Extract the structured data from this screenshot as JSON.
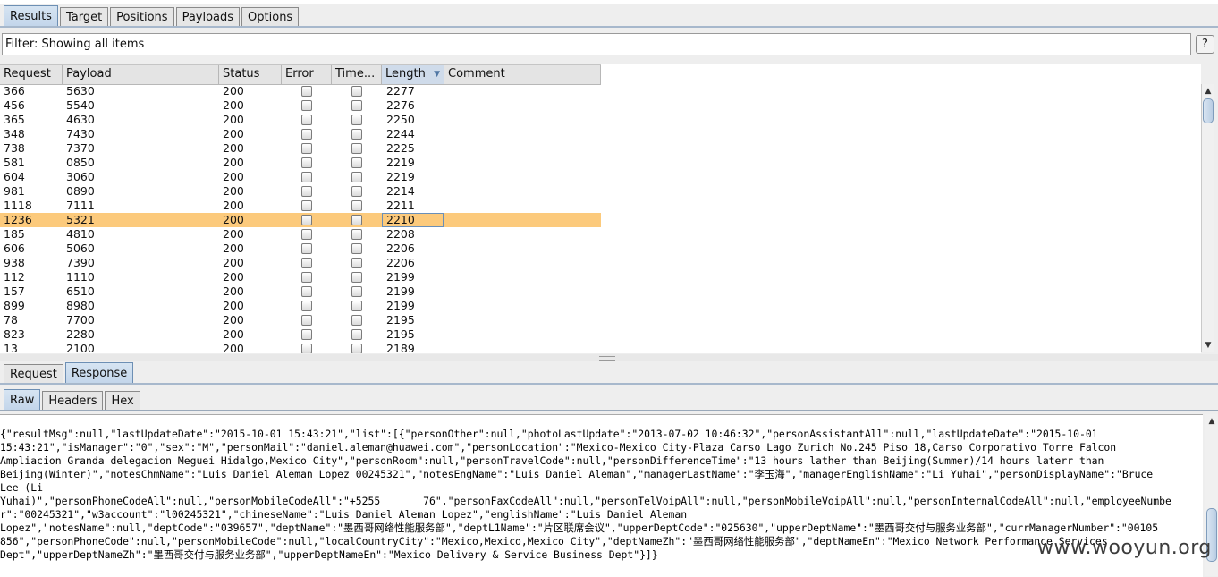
{
  "main_tabs": [
    "Results",
    "Target",
    "Positions",
    "Payloads",
    "Options"
  ],
  "filter_text": "Filter: Showing all items",
  "help_label": "?",
  "columns": [
    "Request",
    "Payload",
    "Status",
    "Error",
    "Time...",
    "Length",
    "Comment"
  ],
  "sort_indicator": "▼",
  "rows": [
    {
      "request": "366",
      "payload": "5630",
      "status": "200",
      "length": "2277"
    },
    {
      "request": "456",
      "payload": "5540",
      "status": "200",
      "length": "2276"
    },
    {
      "request": "365",
      "payload": "4630",
      "status": "200",
      "length": "2250"
    },
    {
      "request": "348",
      "payload": "7430",
      "status": "200",
      "length": "2244"
    },
    {
      "request": "738",
      "payload": "7370",
      "status": "200",
      "length": "2225"
    },
    {
      "request": "581",
      "payload": "0850",
      "status": "200",
      "length": "2219"
    },
    {
      "request": "604",
      "payload": "3060",
      "status": "200",
      "length": "2219"
    },
    {
      "request": "981",
      "payload": "0890",
      "status": "200",
      "length": "2214"
    },
    {
      "request": "1118",
      "payload": "7111",
      "status": "200",
      "length": "2211"
    },
    {
      "request": "1236",
      "payload": "5321",
      "status": "200",
      "length": "2210",
      "selected": true
    },
    {
      "request": "185",
      "payload": "4810",
      "status": "200",
      "length": "2208"
    },
    {
      "request": "606",
      "payload": "5060",
      "status": "200",
      "length": "2206"
    },
    {
      "request": "938",
      "payload": "7390",
      "status": "200",
      "length": "2206"
    },
    {
      "request": "112",
      "payload": "1110",
      "status": "200",
      "length": "2199"
    },
    {
      "request": "157",
      "payload": "6510",
      "status": "200",
      "length": "2199"
    },
    {
      "request": "899",
      "payload": "8980",
      "status": "200",
      "length": "2199"
    },
    {
      "request": "78",
      "payload": "7700",
      "status": "200",
      "length": "2195"
    },
    {
      "request": "823",
      "payload": "2280",
      "status": "200",
      "length": "2195"
    },
    {
      "request": "13",
      "payload": "2100",
      "status": "200",
      "length": "2189"
    }
  ],
  "message_tabs": [
    "Request",
    "Response"
  ],
  "view_tabs": [
    "Raw",
    "Headers",
    "Hex"
  ],
  "raw_lines": [
    "{\"resultMsg\":null,\"lastUpdateDate\":\"2015-10-01 15:43:21\",\"list\":[{\"personOther\":null,\"photoLastUpdate\":\"2013-07-02 10:46:32\",\"personAssistantAll\":null,\"lastUpdateDate\":\"2015-10-01",
    "15:43:21\",\"isManager\":\"0\",\"sex\":\"M\",\"personMail\":\"daniel.aleman@huawei.com\",\"personLocation\":\"Mexico-Mexico City-Plaza Carso Lago Zurich No.245 Piso 18,Carso Corporativo Torre Falcon",
    "Ampliacion Granda delegacion Meguei Hidalgo,Mexico City\",\"personRoom\":null,\"personTravelCode\":null,\"personDifferenceTime\":\"13 hours lather than Beijing(Summer)/14 hours laterr than",
    "Beijing(Winter)\",\"notesChmName\":\"Luis Daniel Aleman Lopez 00245321\",\"notesEngName\":\"Luis Daniel Aleman\",\"managerLastName\":\"李玉海\",\"managerEnglishName\":\"Li Yuhai\",\"personDisplayName\":\"Bruce",
    "Lee (Li",
    "Yuhai)\",\"personPhoneCodeAll\":null,\"personMobileCodeAll\":\"+5255       76\",\"personFaxCodeAll\":null,\"personTelVoipAll\":null,\"personMobileVoipAll\":null,\"personInternalCodeAll\":null,\"employeeNumbe",
    "r\":\"00245321\",\"w3account\":\"l00245321\",\"chineseName\":\"Luis Daniel Aleman Lopez\",\"englishName\":\"Luis Daniel Aleman",
    "Lopez\",\"notesName\":null,\"deptCode\":\"039657\",\"deptName\":\"墨西哥网络性能服务部\",\"deptL1Name\":\"片区联席会议\",\"upperDeptCode\":\"025630\",\"upperDeptName\":\"墨西哥交付与服务业务部\",\"currManagerNumber\":\"00105",
    "856\",\"personPhoneCode\":null,\"personMobileCode\":null,\"localCountryCity\":\"Mexico,Mexico,Mexico City\",\"deptNameZh\":\"墨西哥网络性能服务部\",\"deptNameEn\":\"Mexico Network Performance Services",
    "Dept\",\"upperDeptNameZh\":\"墨西哥交付与服务业务部\",\"upperDeptNameEn\":\"Mexico Delivery & Service Business Dept\"}]}"
  ],
  "watermark": "www.wooyun.org"
}
